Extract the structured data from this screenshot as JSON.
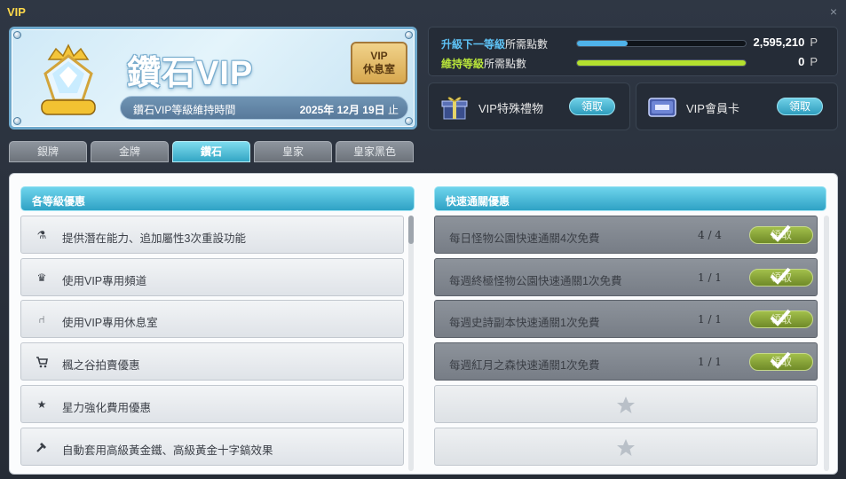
{
  "window": {
    "title": "VIP",
    "close_glyph": "×"
  },
  "banner": {
    "name": "鑽石VIP",
    "lounge_line1": "VIP",
    "lounge_line2": "休息室",
    "maintain_label": "鑽石VIP等級維持時間",
    "maintain_date": "2025年 12月 19日",
    "maintain_suffix": "止"
  },
  "points": {
    "upgrade": {
      "label_strong": "升級下一等級",
      "label_rest": "所需點數",
      "value": "2,595,210",
      "unit": "P",
      "progress": 0.3,
      "color": "#4fb3ea"
    },
    "maintain": {
      "label_strong": "維持等級",
      "label_rest": "所需點數",
      "value": "0",
      "unit": "P",
      "progress": 1.0,
      "color": "#b4e02e"
    }
  },
  "gifts": [
    {
      "label": "VIP特殊禮物",
      "button": "領取"
    },
    {
      "label": "VIP會員卡",
      "button": "領取"
    }
  ],
  "tabs": [
    {
      "label": "銀牌",
      "active": false
    },
    {
      "label": "金牌",
      "active": false
    },
    {
      "label": "鑽石",
      "active": true
    },
    {
      "label": "皇家",
      "active": false
    },
    {
      "label": "皇家黑色",
      "active": false
    }
  ],
  "left_panel": {
    "header": "各等級優惠",
    "items": [
      {
        "icon": "potential-reset-icon",
        "glyph": "⚗",
        "label": "提供潛在能力、追加屬性3次重設功能"
      },
      {
        "icon": "crown-icon",
        "glyph": "♛",
        "label": "使用VIP專用頻道"
      },
      {
        "icon": "chair-icon",
        "glyph": "⑁",
        "label": "使用VIP專用休息室"
      },
      {
        "icon": "cart-icon",
        "glyph": "🛒",
        "label": "楓之谷拍賣優惠"
      },
      {
        "icon": "star-icon",
        "glyph": "★",
        "label": "星力強化費用優惠"
      },
      {
        "icon": "hammer-icon",
        "glyph": "⚒",
        "label": "自動套用高級黃金鐵、高級黃金十字鎬效果"
      }
    ]
  },
  "right_panel": {
    "header": "快速通關優惠",
    "items": [
      {
        "label": "每日怪物公園快速通關4次免費",
        "count": "4 / 4",
        "button": "領取"
      },
      {
        "label": "每週終極怪物公園快速通關1次免費",
        "count": "1 / 1",
        "button": "領取"
      },
      {
        "label": "每週史詩副本快速通關1次免費",
        "count": "1 / 1",
        "button": "領取"
      },
      {
        "label": "每週紅月之森快速通關1次免費",
        "count": "1 / 1",
        "button": "領取"
      }
    ],
    "empty_slots": 2
  }
}
